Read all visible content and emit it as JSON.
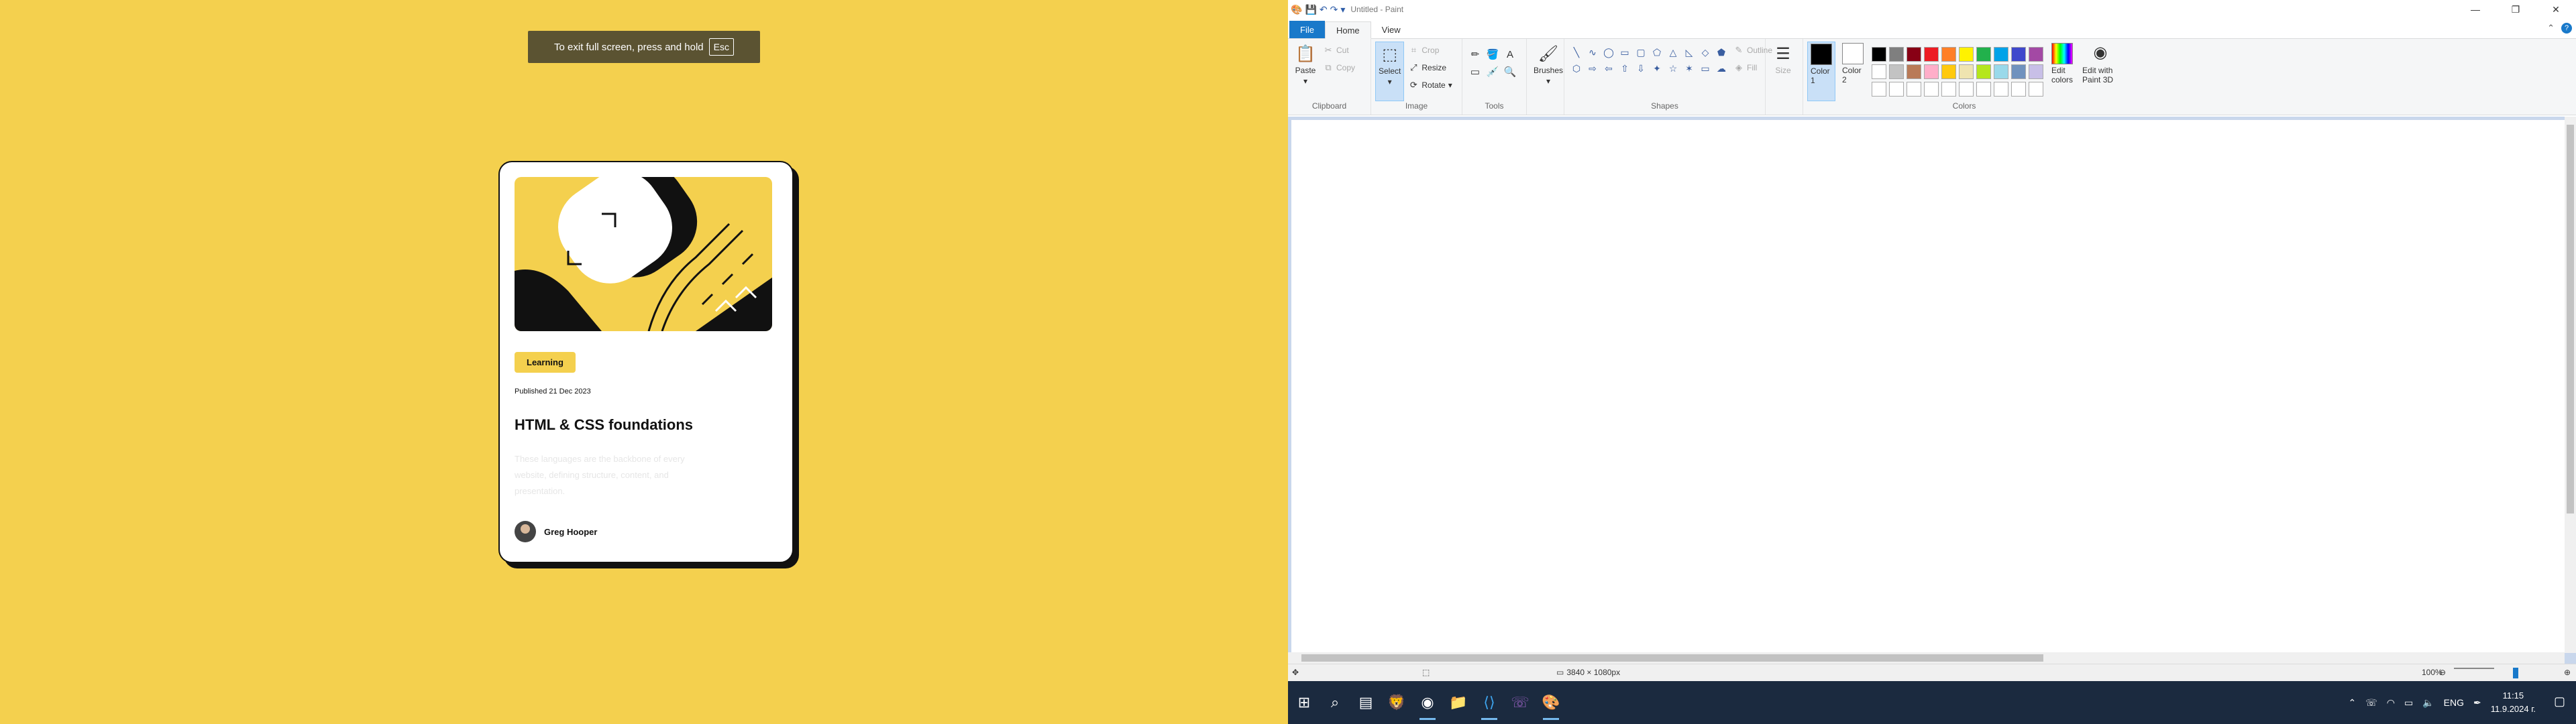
{
  "fullscreen_notice": {
    "text": "To exit full screen, press and hold",
    "key": "Esc"
  },
  "card": {
    "tag": "Learning",
    "published": "Published 21 Dec 2023",
    "title": "HTML & CSS foundations",
    "description": "These languages are the backbone of every website, defining structure, content, and presentation.",
    "author": "Greg Hooper"
  },
  "paint": {
    "window_title": "Untitled - Paint",
    "tabs": {
      "file": "File",
      "home": "Home",
      "view": "View"
    },
    "clipboard": {
      "paste": "Paste",
      "cut": "Cut",
      "copy": "Copy",
      "label": "Clipboard"
    },
    "image": {
      "select": "Select",
      "crop": "Crop",
      "resize": "Resize",
      "rotate": "Rotate",
      "label": "Image"
    },
    "tools": {
      "label": "Tools",
      "brushes": "Brushes"
    },
    "shapes": {
      "label": "Shapes",
      "outline": "Outline",
      "fill": "Fill"
    },
    "size": "Size",
    "colors": {
      "color1": "Color 1",
      "color2": "Color 2",
      "edit": "Edit colors",
      "paint3d": "Edit with Paint 3D",
      "label": "Colors",
      "palette": [
        "#000000",
        "#7f7f7f",
        "#880015",
        "#ed1c24",
        "#ff7f27",
        "#fff200",
        "#22b14c",
        "#00a2e8",
        "#3f48cc",
        "#a349a4",
        "#ffffff",
        "#c3c3c3",
        "#b97a57",
        "#ffaec9",
        "#ffc90e",
        "#efe4b0",
        "#b5e61d",
        "#99d9ea",
        "#7092be",
        "#c8bfe7",
        "#ffffff",
        "#ffffff",
        "#ffffff",
        "#ffffff",
        "#ffffff",
        "#ffffff",
        "#ffffff",
        "#ffffff",
        "#ffffff",
        "#ffffff"
      ],
      "color1_value": "#000000",
      "color2_value": "#ffffff"
    },
    "status": {
      "dimensions": "3840 × 1080px",
      "zoom": "100%"
    }
  },
  "taskbar": {
    "language": "ENG",
    "time": "11:15",
    "date": "11.9.2024 г."
  }
}
